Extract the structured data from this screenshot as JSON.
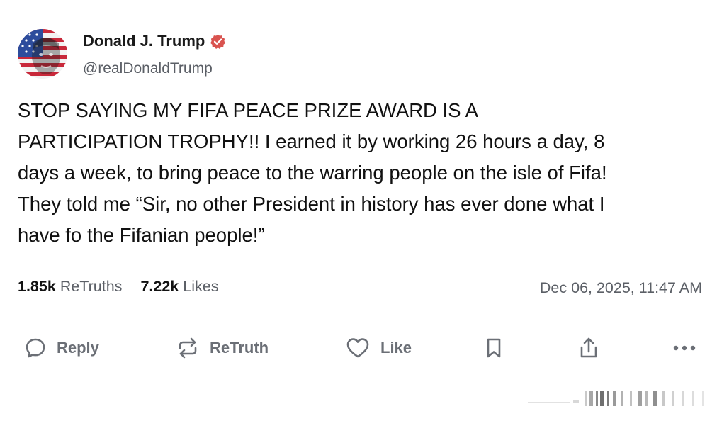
{
  "author": {
    "name": "Donald J. Trump",
    "handle": "@realDonaldTrump",
    "verified_icon": "verified-badge-icon"
  },
  "post": {
    "lines": [
      "STOP SAYING MY FIFA PEACE PRIZE AWARD IS A",
      "PARTICIPATION TROPHY!! I earned it by working 26 hours a day, 8",
      "days a week, to bring peace to the warring people on the isle of Fifa!",
      "They told me “Sir, no other President in history has ever done what I",
      "have fo the Fifanian people!”"
    ]
  },
  "stats": {
    "retruths_count": "1.85k",
    "retruths_label": "ReTruths",
    "likes_count": "7.22k",
    "likes_label": "Likes",
    "timestamp": "Dec 06, 2025, 11:47 AM"
  },
  "actions": {
    "reply_label": "Reply",
    "retruth_label": "ReTruth",
    "like_label": "Like"
  },
  "colors": {
    "verified_badge": "#d9534f",
    "muted_text": "#5b5f66",
    "icon_gray": "#6b6f76"
  }
}
